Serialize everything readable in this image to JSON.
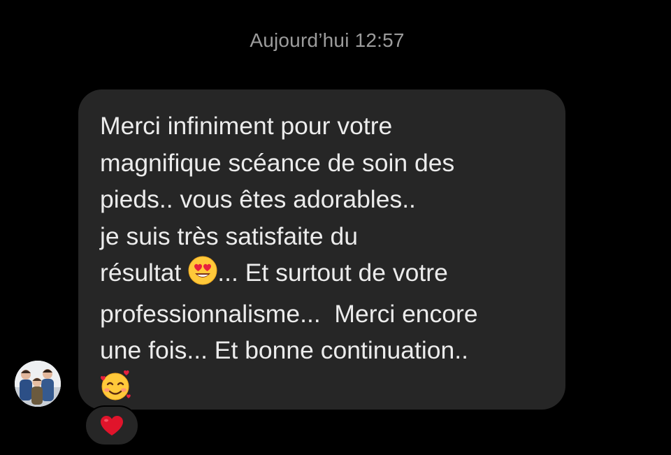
{
  "header": {
    "timestamp": "Aujourd’hui 12:57"
  },
  "message": {
    "lines": [
      "Merci infiniment pour votre",
      "magnifique scéance de soin des",
      "pieds.. vous êtes adorables..",
      "je suis très satisfaite du",
      "résultat",
      "... Et surtout de votre",
      "professionnalisme...  Merci encore",
      "une fois... Et bonne continuation.."
    ],
    "emojis": {
      "inline": "heart-eyes-emoji",
      "final": "smiling-face-with-hearts-emoji"
    },
    "colors": {
      "bubble": "#262626",
      "text": "#ececec"
    }
  },
  "sender": {
    "avatar": "avatar-photo-children"
  },
  "reaction": {
    "icon": "red-heart-icon",
    "color": "#e0142b"
  },
  "colors": {
    "background": "#000000",
    "timestamp": "#9c9c9c"
  }
}
